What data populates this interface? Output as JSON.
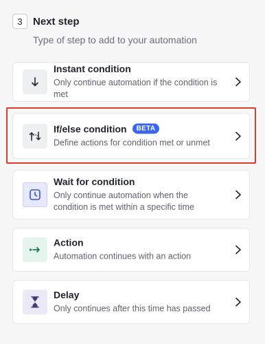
{
  "header": {
    "step_number": "3",
    "title": "Next step",
    "subtitle": "Type of step to add to your automation"
  },
  "options": [
    {
      "title": "Instant condition",
      "description": "Only continue automation if the condition is met",
      "icon": "arrow-down-icon",
      "icon_bg": "#eeeff1",
      "icon_color": "#1f2329"
    },
    {
      "title": "If/else condition",
      "badge": "BETA",
      "description": "Define actions for condition met or unmet",
      "icon": "branch-arrows-icon",
      "icon_bg": "#eeeff1",
      "icon_color": "#1f2329",
      "highlighted": true
    },
    {
      "title": "Wait for condition",
      "description": "Only continue automation when the condition is met within a specific time",
      "icon": "clock-icon",
      "icon_bg": "#e6e9fb",
      "icon_color": "#3b52c4"
    },
    {
      "title": "Action",
      "description": "Automation continues with an action",
      "icon": "action-arrow-icon",
      "icon_bg": "#e5f4ec",
      "icon_color": "#1e7a4a"
    },
    {
      "title": "Delay",
      "description": "Only continues after this time has passed",
      "icon": "hourglass-icon",
      "icon_bg": "#ece9f7",
      "icon_color": "#3d3a7a"
    }
  ],
  "colors": {
    "accent": "#3b66e8",
    "highlight_border": "#e0392b"
  }
}
